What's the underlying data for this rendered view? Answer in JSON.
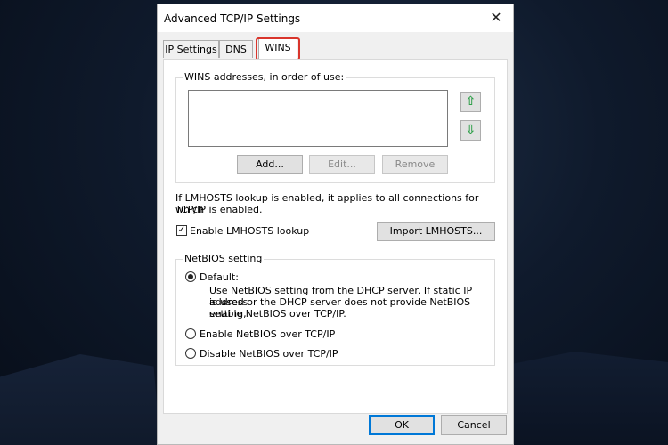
{
  "dialog": {
    "title": "Advanced TCP/IP Settings",
    "close_glyph": "✕",
    "tabs": [
      {
        "label": "IP Settings",
        "active": false
      },
      {
        "label": "DNS",
        "active": false
      },
      {
        "label": "WINS",
        "active": true
      }
    ],
    "highlight_color": "#d9352c"
  },
  "wins": {
    "group_label": "WINS addresses, in order of use:",
    "up_glyph": "⇧",
    "down_glyph": "⇩",
    "add_label": "Add...",
    "edit_label": "Edit...",
    "remove_label": "Remove"
  },
  "lmhosts": {
    "info_line1": "If LMHOSTS lookup is enabled, it applies to all connections for which",
    "info_line2": "TCP/IP is enabled.",
    "checkbox_label": "Enable LMHOSTS lookup",
    "checked": true,
    "import_label": "Import LMHOSTS..."
  },
  "netbios": {
    "group_label": "NetBIOS setting",
    "default_label": "Default:",
    "default_desc_line1": "Use NetBIOS setting from the DHCP server. If static IP address",
    "default_desc_line2": "is used or the DHCP server does not provide NetBIOS setting,",
    "default_desc_line3": "enable NetBIOS over TCP/IP.",
    "enable_label": "Enable NetBIOS over TCP/IP",
    "disable_label": "Disable NetBIOS over TCP/IP",
    "selected": "default"
  },
  "footer": {
    "ok_label": "OK",
    "cancel_label": "Cancel"
  },
  "colors": {
    "accent": "#0078d7",
    "arrow_green": "#31a04b"
  }
}
